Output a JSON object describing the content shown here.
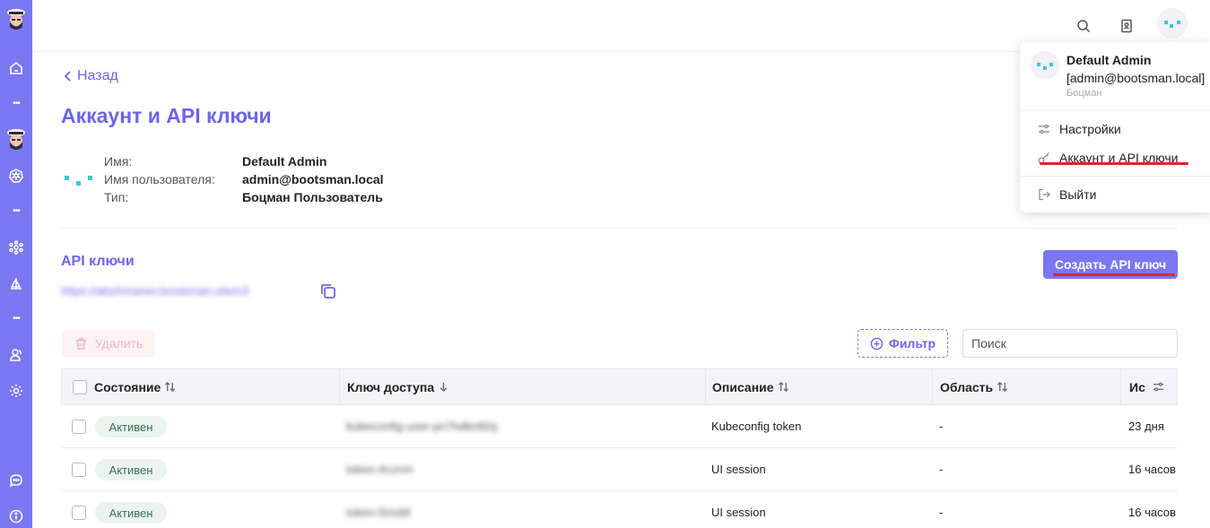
{
  "nav": {
    "back_label": "Назад",
    "page_title": "Аккаунт и API ключи"
  },
  "account": {
    "labels": {
      "name": "Имя:",
      "username": "Имя пользователя:",
      "type": "Тип:"
    },
    "values": {
      "name": "Default Admin",
      "username": "admin@bootsman.local",
      "type": "Боцман Пользователь"
    }
  },
  "api": {
    "section_title": "API ключи",
    "endpoint_url": "https://akizhmanev.bootsman.site/v3",
    "create_label": "Создать API ключ",
    "delete_label": "Удалить",
    "filter_label": "Фильтр",
    "search_placeholder": "Поиск"
  },
  "table": {
    "columns": [
      "Состояние",
      "Ключ доступа",
      "Описание",
      "Область",
      "Ис"
    ],
    "rows": [
      {
        "state": "Активен",
        "key": "kubeconfig-user-pn7hdkn82q",
        "description": "Kubeconfig token",
        "scope": "-",
        "expires": "23 дня"
      },
      {
        "state": "Активен",
        "key": "token-4cznm",
        "description": "UI session",
        "scope": "-",
        "expires": "16 часов"
      },
      {
        "state": "Активен",
        "key": "token-5msbf",
        "description": "UI session",
        "scope": "-",
        "expires": "16 часов"
      }
    ]
  },
  "user_menu": {
    "name": "Default Admin",
    "email": "[admin@bootsman.local]",
    "role": "Боцман",
    "items": [
      "Настройки",
      "Аккаунт и API ключи",
      "Выйти"
    ]
  },
  "colors": {
    "accent": "#7b77f2",
    "accent_text": "#6b66e8",
    "active_badge_bg": "#eaf3ee",
    "annotation_red": "#e0242e"
  }
}
